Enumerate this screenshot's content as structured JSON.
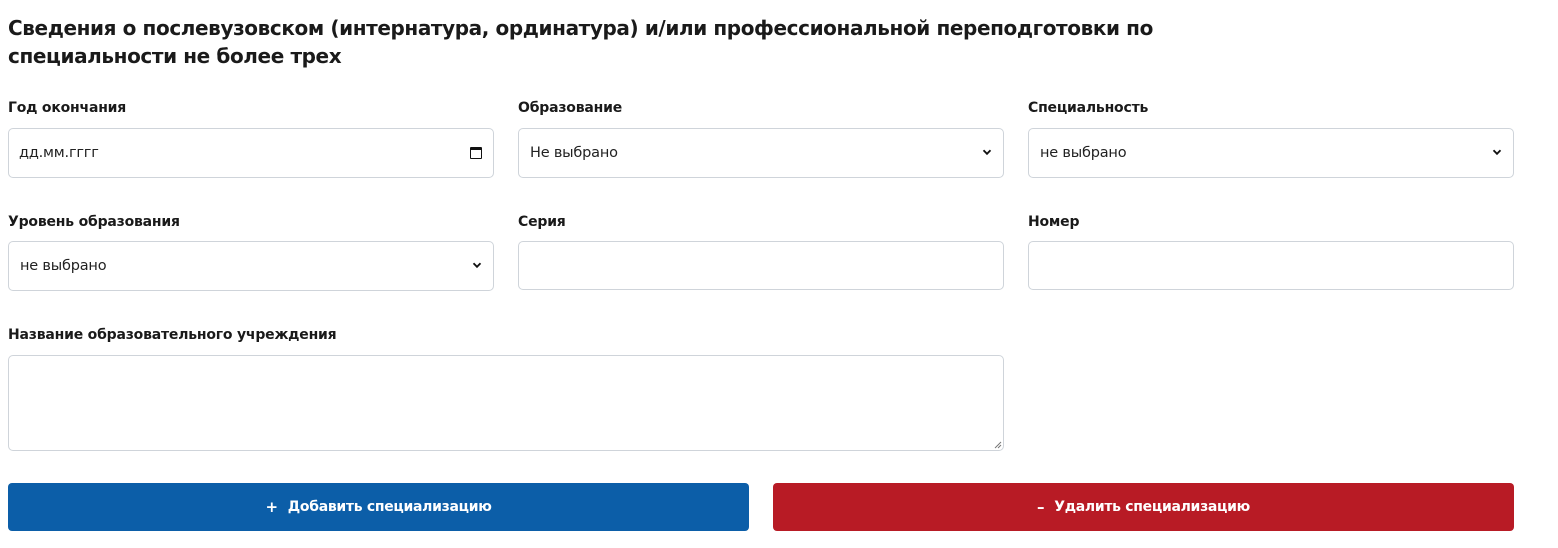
{
  "section": {
    "title": "Сведения о послевузовском (интернатура, ординатура) и/или профессиональной переподготовки по специальности не более трех"
  },
  "fields": {
    "graduation_year": {
      "label": "Год окончания",
      "value": "дд.мм.гггг"
    },
    "education": {
      "label": "Образование",
      "value": "Не выбрано"
    },
    "specialty": {
      "label": "Специальность",
      "value": "не выбрано"
    },
    "education_level": {
      "label": "Уровень образования",
      "value": "не выбрано"
    },
    "series": {
      "label": "Серия",
      "value": ""
    },
    "number": {
      "label": "Номер",
      "value": ""
    },
    "institution_name": {
      "label": "Название образовательного учреждения",
      "value": ""
    }
  },
  "actions": {
    "add": {
      "icon": "plus-icon",
      "glyph": "+",
      "label": "Добавить специализацию",
      "color": "#0c5ea8"
    },
    "remove": {
      "icon": "minus-icon",
      "glyph": "–",
      "label": "Удалить специализацию",
      "color": "#b81b25"
    }
  }
}
